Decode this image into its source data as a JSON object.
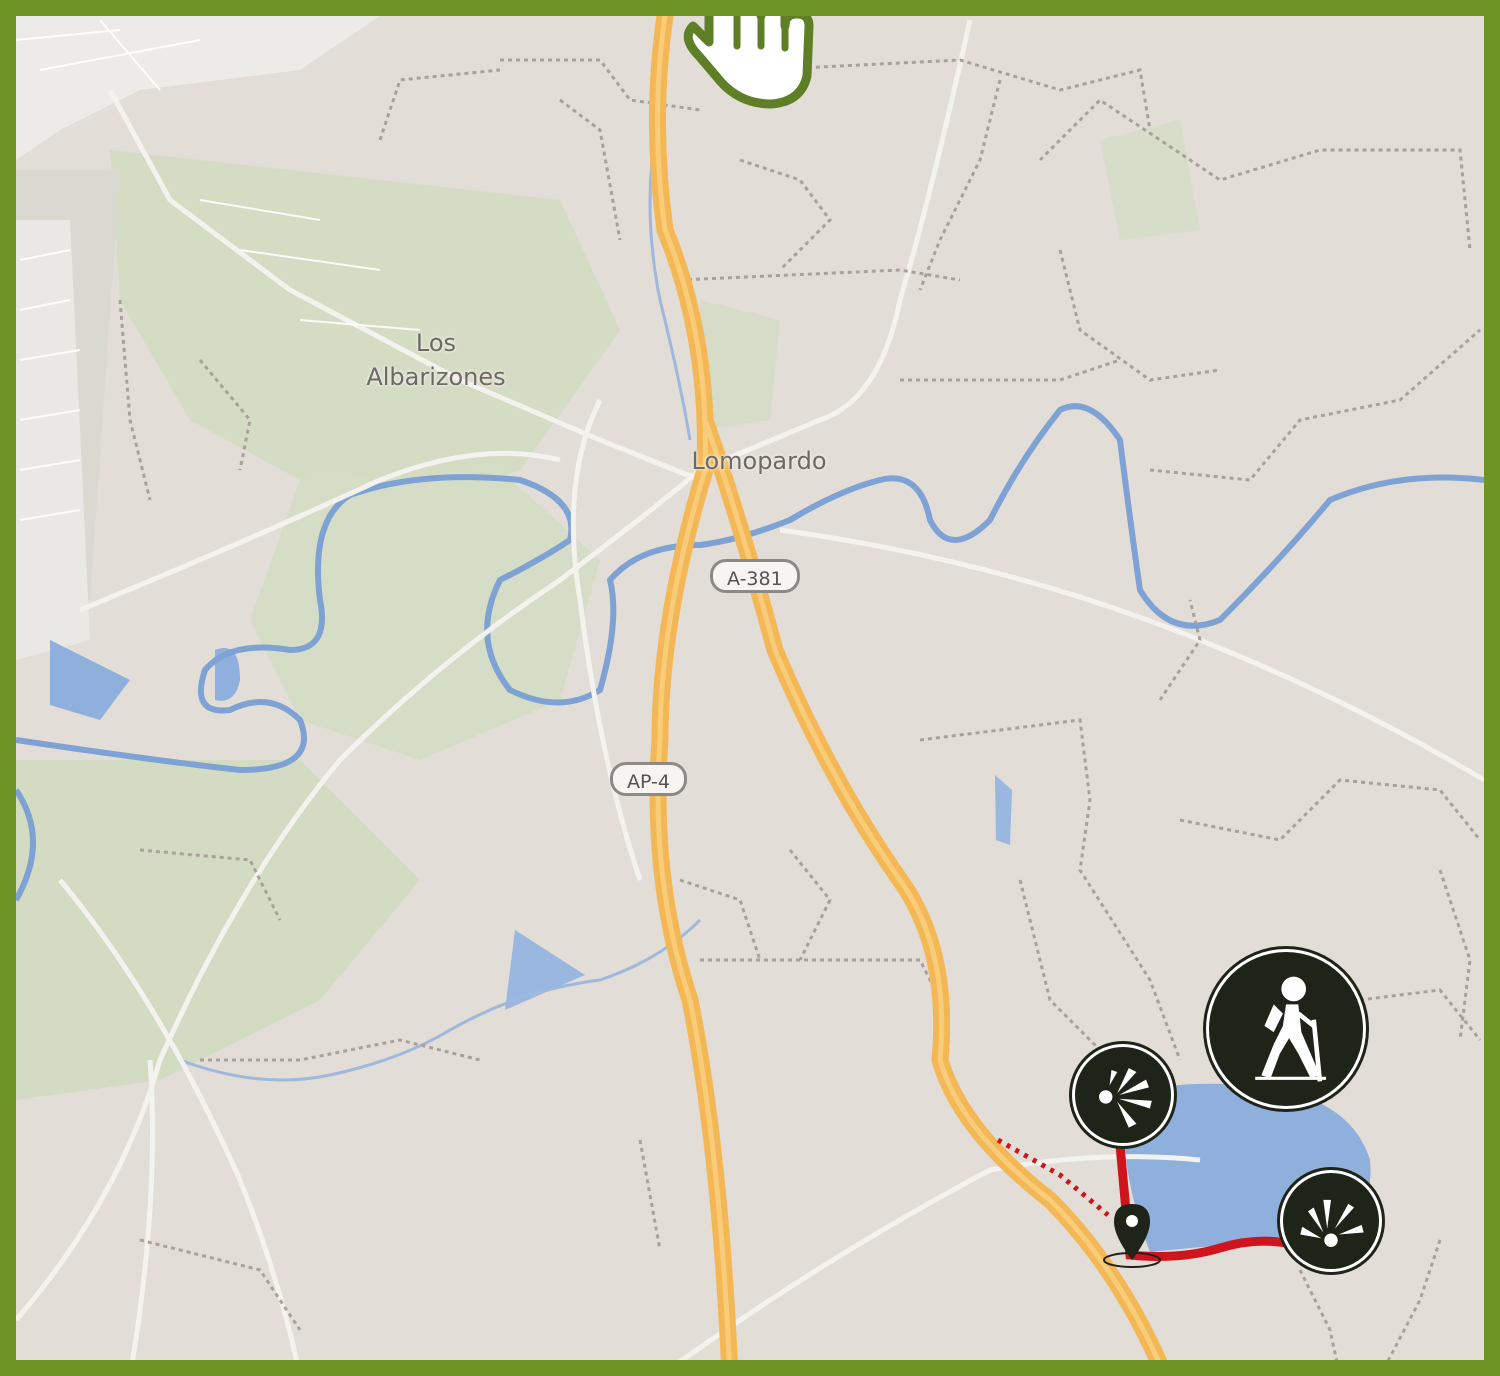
{
  "map": {
    "places": [
      {
        "id": "los-albarizones",
        "line1": "Los",
        "line2": "Albarizones"
      },
      {
        "id": "lomopardo",
        "line1": "Lomopardo"
      }
    ],
    "road_shields": [
      {
        "id": "a-381",
        "text": "A-381"
      },
      {
        "id": "ap-4",
        "text": "AP-4"
      }
    ],
    "colors": {
      "frame": "#6f9426",
      "land": "#e2ddd6",
      "green_area": "#d3dcc4",
      "water": "#8fb0dc",
      "river": "#7ea2d4",
      "motorway": "#f3b855",
      "route": "#d0141d",
      "poi_fill": "#1f2419"
    },
    "markers": [
      {
        "id": "hiking-marker",
        "icon": "hiker-icon"
      },
      {
        "id": "viewpoint-marker-1",
        "icon": "viewpoint-icon"
      },
      {
        "id": "viewpoint-marker-2",
        "icon": "viewpoint-icon"
      },
      {
        "id": "location-pin",
        "icon": "map-pin-icon"
      }
    ],
    "cursor": {
      "icon": "hand-pointer-icon"
    }
  }
}
